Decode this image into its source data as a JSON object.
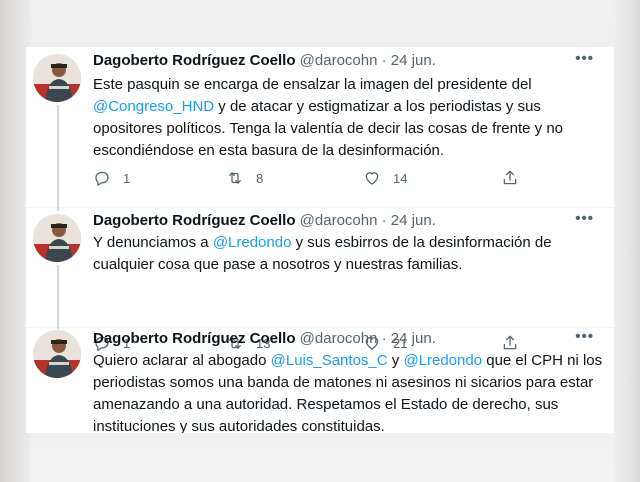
{
  "tweets": [
    {
      "author": "Dagoberto Rodríguez Coello",
      "handle": "@darocohn",
      "separator": "·",
      "date": "24 jun.",
      "more": "•••",
      "body": [
        {
          "text": "Este pasquin se encarga de ensalzar la imagen del presidente del ",
          "mention": false
        },
        {
          "text": "@Congreso_HND",
          "mention": true
        },
        {
          "text": " y de atacar y estigmatizar a los periodistas y sus opositores políticos. Tenga la valentía de decir las cosas de frente y no escondiéndose en esta basura de la desinformación.",
          "mention": false
        }
      ],
      "replies": "1",
      "retweets": "8",
      "likes": "14"
    },
    {
      "author": "Dagoberto Rodríguez Coello",
      "handle": "@darocohn",
      "separator": "·",
      "date": "24 jun.",
      "more": "•••",
      "body": [
        {
          "text": "Y denunciamos a ",
          "mention": false
        },
        {
          "text": "@Lredondo",
          "mention": true
        },
        {
          "text": " y sus esbirros de la desinformación de cualquier cosa que pase a nosotros y nuestras familias.",
          "mention": false
        }
      ],
      "replies": "1",
      "retweets": "13",
      "likes": "21"
    },
    {
      "author": "Dagoberto Rodríguez Coello",
      "handle": "@darocohn",
      "separator": "·",
      "date": "24 jun.",
      "more": "•••",
      "body": [
        {
          "text": "Quiero aclarar al abogado ",
          "mention": false
        },
        {
          "text": "@Luis_Santos_C",
          "mention": true
        },
        {
          "text": " y ",
          "mention": false
        },
        {
          "text": "@Lredondo",
          "mention": true
        },
        {
          "text": " que el CPH ni los periodistas somos una banda de matones ni asesinos ni sicarios para estar amenazando a una autoridad. Respetamos el Estado de derecho, sus instituciones y sus autoridades constituidas.",
          "mention": false
        }
      ]
    }
  ],
  "colors": {
    "mention": "#1d9bf0",
    "text": "#0f1419",
    "secondary": "#536471",
    "thread_line": "#cfd9de"
  },
  "icons": {
    "reply": "reply-icon",
    "retweet": "retweet-icon",
    "like": "heart-icon",
    "share": "share-icon",
    "more": "more-icon"
  }
}
